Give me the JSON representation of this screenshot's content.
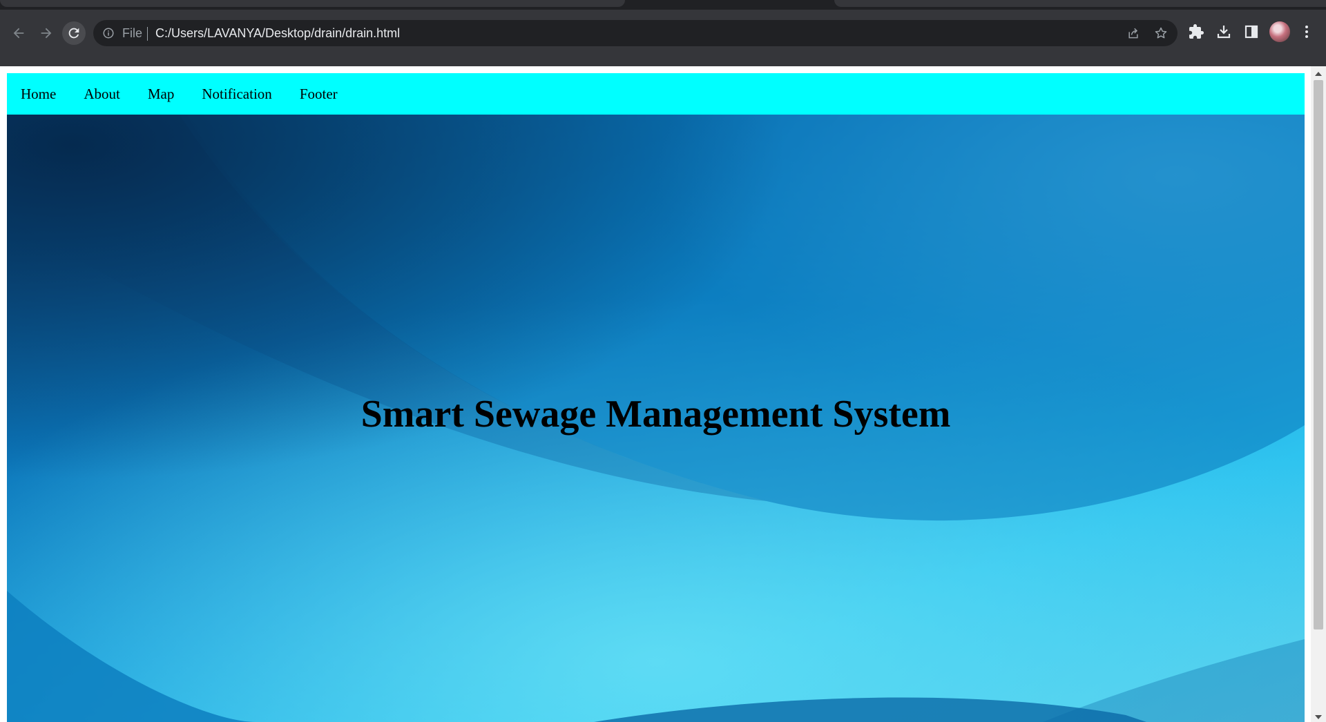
{
  "browser": {
    "scheme_label": "File",
    "url": "C:/Users/LAVANYA/Desktop/drain/drain.html"
  },
  "nav": {
    "items": [
      "Home",
      "About",
      "Map",
      "Notification",
      "Footer"
    ]
  },
  "hero": {
    "title": "Smart Sewage Management System"
  },
  "colors": {
    "navbar_bg": "#00ffff",
    "chrome_toolbar": "#35363a",
    "omnibox_bg": "#202124"
  }
}
